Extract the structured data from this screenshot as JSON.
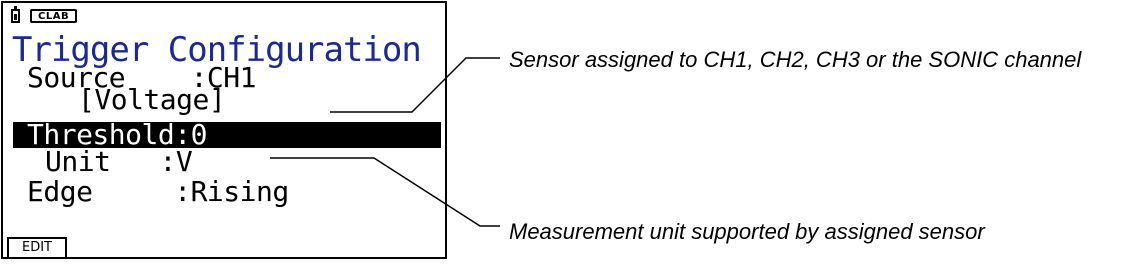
{
  "screen": {
    "mode_badge": "CLAB",
    "title": "Trigger Configuration",
    "rows": {
      "source": "Source    :CH1",
      "voltage": "[Voltage]",
      "threshold": "Threshold:0",
      "unit": "Unit   :V",
      "edge": "Edge     :Rising"
    },
    "function_keys": [
      "EDIT"
    ]
  },
  "annotations": {
    "sensor_note": "Sensor assigned to CH1, CH2, CH3 or the SONIC channel",
    "unit_note": "Measurement unit supported by assigned sensor"
  },
  "colors": {
    "title": "#1b2a8c",
    "highlight_bg": "#000000",
    "highlight_text": "#ffffff"
  },
  "icons": [
    "battery-icon"
  ]
}
